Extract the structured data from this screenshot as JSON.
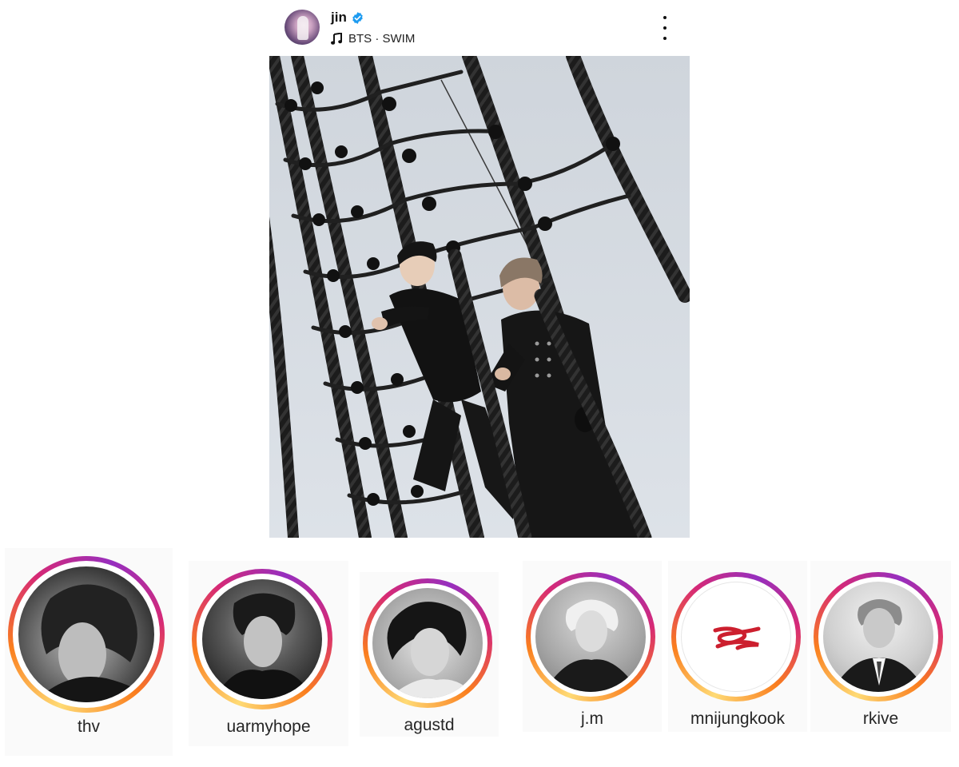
{
  "post": {
    "username": "jin",
    "music": "BTS · SWIM",
    "icons": {
      "verified": "verified-badge-icon",
      "music": "music-note-icon",
      "more": "more-options-icon"
    },
    "colors": {
      "verified": "#1d9bf0",
      "sky": "#d8dde3",
      "rope": "#1a1a1a"
    }
  },
  "stories": [
    {
      "username": "thv"
    },
    {
      "username": "uarmyhope"
    },
    {
      "username": "agustd"
    },
    {
      "username": "j.m"
    },
    {
      "username": "mnijungkook"
    },
    {
      "username": "rkive"
    }
  ],
  "colors": {
    "story_ring": [
      "#feda75",
      "#fa7e1e",
      "#d62976",
      "#962fbf"
    ]
  }
}
